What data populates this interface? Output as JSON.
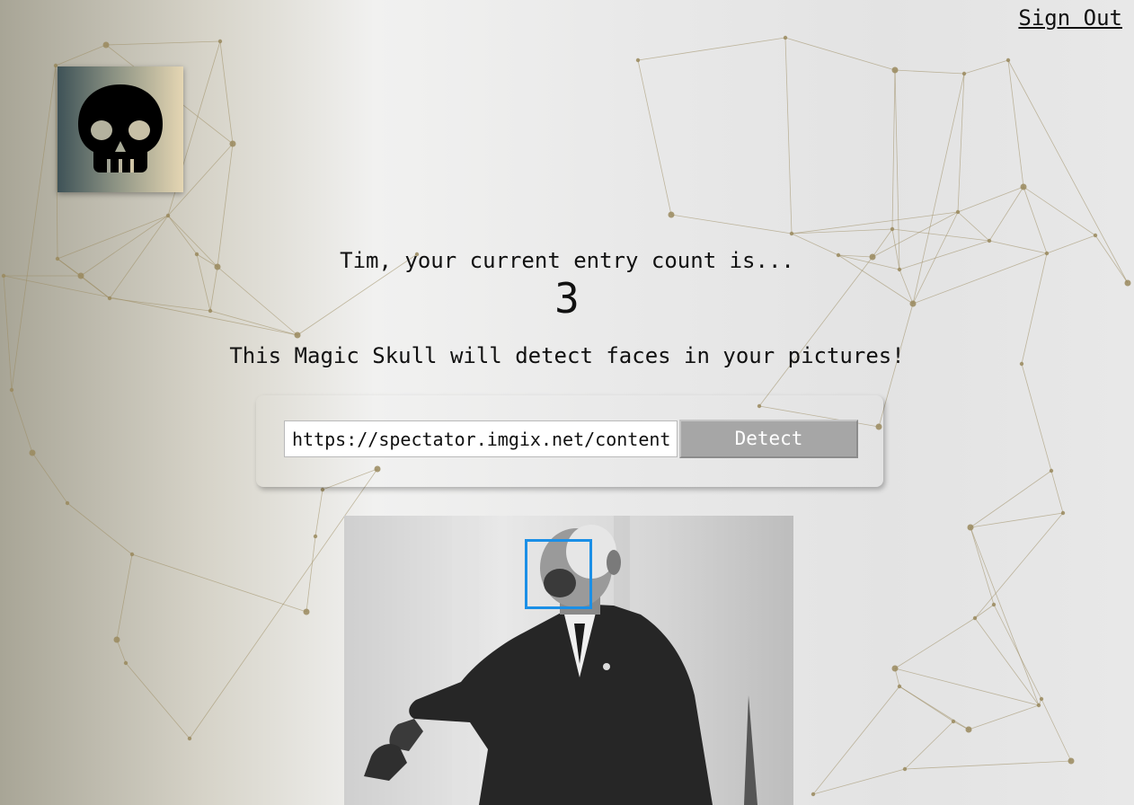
{
  "header": {
    "signout_label": "Sign Out"
  },
  "logo": {
    "icon": "skull-icon"
  },
  "rank": {
    "user_name": "Tim",
    "message": "Tim, your current entry count is...",
    "entry_count": "3"
  },
  "intro": {
    "tagline": "This Magic Skull will detect faces in your pictures!"
  },
  "form": {
    "url_value": "https://spectator.imgix.net/content/",
    "detect_label": "Detect"
  },
  "result": {
    "image_alt": "black and white photo of a man speaking",
    "faces_detected": 1
  },
  "colors": {
    "face_box": "#1b8fe6",
    "network_line": "#9a8a5e",
    "button_bg": "#a6a6a6"
  }
}
